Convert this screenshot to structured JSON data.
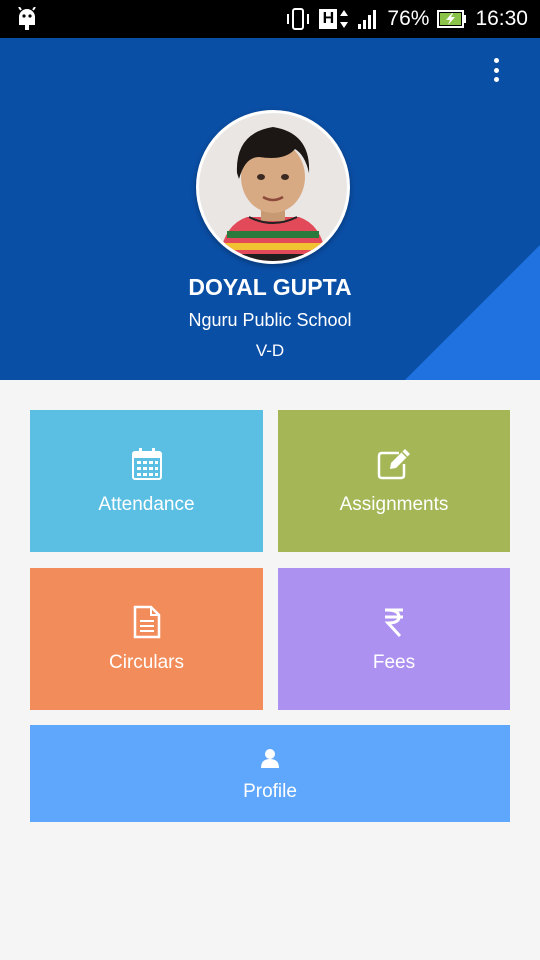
{
  "status_bar": {
    "battery": "76%",
    "time": "16:30",
    "network_label": "H",
    "icons": [
      "android-debug-icon",
      "vibrate-icon",
      "network-h-icon",
      "signal-icon",
      "battery-charging-icon"
    ]
  },
  "header": {
    "student_name": "DOYAL GUPTA",
    "school_name": "Nguru Public School",
    "class_section": "V-D",
    "menu_icon": "more-vert-icon",
    "colors": {
      "primary": "#0a4fa6",
      "accent": "#1f72e0"
    }
  },
  "tiles": {
    "attendance": {
      "label": "Attendance",
      "icon": "calendar-icon",
      "color": "#5bbfe3"
    },
    "assignments": {
      "label": "Assignments",
      "icon": "edit-icon",
      "color": "#a5b656"
    },
    "circulars": {
      "label": "Circulars",
      "icon": "document-icon",
      "color": "#f28c5a"
    },
    "fees": {
      "label": "Fees",
      "icon": "rupee-icon",
      "color": "#ad91f0"
    },
    "profile": {
      "label": "Profile",
      "icon": "user-icon",
      "color": "#5fa7fc"
    }
  }
}
